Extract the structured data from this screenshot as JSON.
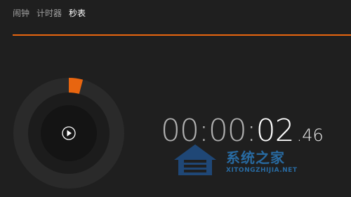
{
  "tabs": [
    {
      "label": "闹钟",
      "active": false
    },
    {
      "label": "计时器",
      "active": false
    },
    {
      "label": "秒表",
      "active": true
    }
  ],
  "accent_color": "#e8650f",
  "stopwatch": {
    "hm_prefix": "00:00:",
    "seconds": "02",
    "centiseconds": ".46",
    "elapsed_seconds": 2.46
  },
  "play_button": {
    "icon": "play-icon"
  },
  "watermark": {
    "text": "系统之家",
    "subtext": "XITONGZHIJIA.NET"
  }
}
